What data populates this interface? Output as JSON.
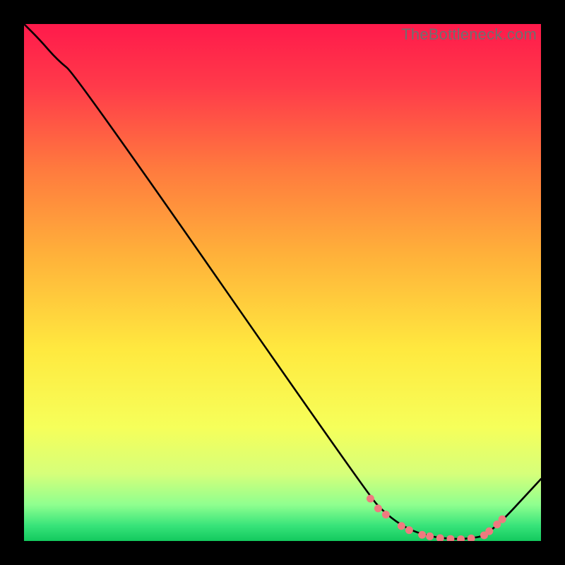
{
  "watermark": "TheBottleneck.com",
  "chart_data": {
    "type": "line",
    "title": "",
    "xlabel": "",
    "ylabel": "",
    "xlim": [
      0,
      100
    ],
    "ylim": [
      0,
      100
    ],
    "grid": false,
    "legend": false,
    "gradient_stops": [
      {
        "offset": 0,
        "color": "#ff1a4b"
      },
      {
        "offset": 12,
        "color": "#ff3a4a"
      },
      {
        "offset": 28,
        "color": "#ff7a3e"
      },
      {
        "offset": 45,
        "color": "#ffb23a"
      },
      {
        "offset": 63,
        "color": "#ffe93f"
      },
      {
        "offset": 78,
        "color": "#f6ff5a"
      },
      {
        "offset": 87,
        "color": "#d6ff7a"
      },
      {
        "offset": 93,
        "color": "#8fff8f"
      },
      {
        "offset": 97,
        "color": "#38e47a"
      },
      {
        "offset": 100,
        "color": "#13c95e"
      }
    ],
    "series": [
      {
        "name": "bottleneck-curve",
        "color": "#000000",
        "x": [
          0.0,
          3.0,
          6.5,
          10.0,
          66.5,
          70.0,
          74.0,
          78.0,
          82.0,
          86.0,
          90.0,
          100.0
        ],
        "y": [
          100.0,
          97.0,
          93.0,
          90.2,
          9.0,
          5.2,
          2.4,
          1.0,
          0.4,
          0.4,
          1.2,
          12.0
        ]
      }
    ],
    "markers": {
      "color": "#ef7a7f",
      "radius": 5.5,
      "points": [
        {
          "x": 67.0,
          "y": 8.2
        },
        {
          "x": 68.5,
          "y": 6.3
        },
        {
          "x": 70.0,
          "y": 5.1
        },
        {
          "x": 73.0,
          "y": 2.9
        },
        {
          "x": 74.5,
          "y": 2.1
        },
        {
          "x": 77.0,
          "y": 1.2
        },
        {
          "x": 78.5,
          "y": 0.9
        },
        {
          "x": 80.5,
          "y": 0.55
        },
        {
          "x": 82.5,
          "y": 0.4
        },
        {
          "x": 84.5,
          "y": 0.35
        },
        {
          "x": 86.5,
          "y": 0.5
        },
        {
          "x": 89.0,
          "y": 1.1
        },
        {
          "x": 90.0,
          "y": 1.9
        },
        {
          "x": 91.5,
          "y": 3.2
        },
        {
          "x": 92.5,
          "y": 4.2
        }
      ]
    }
  }
}
